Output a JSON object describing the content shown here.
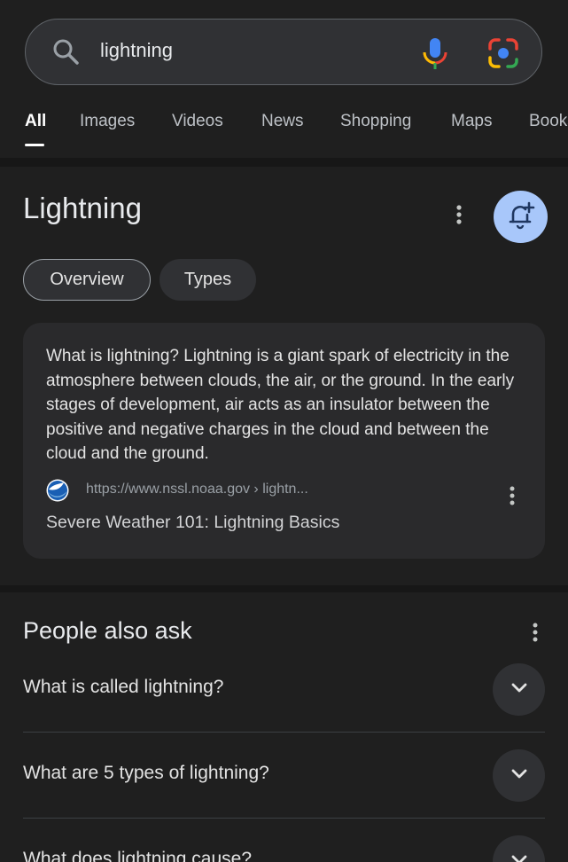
{
  "search": {
    "query": "lightning"
  },
  "tabs": [
    {
      "label": "All",
      "active": true
    },
    {
      "label": "Images"
    },
    {
      "label": "Videos"
    },
    {
      "label": "News"
    },
    {
      "label": "Shopping"
    },
    {
      "label": "Maps"
    },
    {
      "label": "Books"
    }
  ],
  "knowledge_panel": {
    "title": "Lightning",
    "chips": [
      "Overview",
      "Types"
    ],
    "card": {
      "text": "What is lightning? Lightning is a giant spark of electricity in the atmosphere between clouds, the air, or the ground. In the early stages of development, air acts as an insulator between the positive and negative charges in the cloud and between the cloud and the ground.",
      "source_url": "https://www.nssl.noaa.gov › lightn...",
      "source_title": "Severe Weather 101: Lightning Basics"
    }
  },
  "people_also_ask": {
    "title": "People also ask",
    "questions": [
      "What is called lightning?",
      "What are 5 types of lightning?",
      "What does lightning cause?"
    ]
  },
  "colors": {
    "background": "#1f1f1f",
    "accent": "#a8c7fa",
    "card": "#2a2a2c"
  },
  "icons": [
    "search-icon",
    "mic-icon",
    "lens-icon",
    "more-vert-icon",
    "bell-plus-icon",
    "noaa-logo",
    "chevron-down-icon"
  ]
}
